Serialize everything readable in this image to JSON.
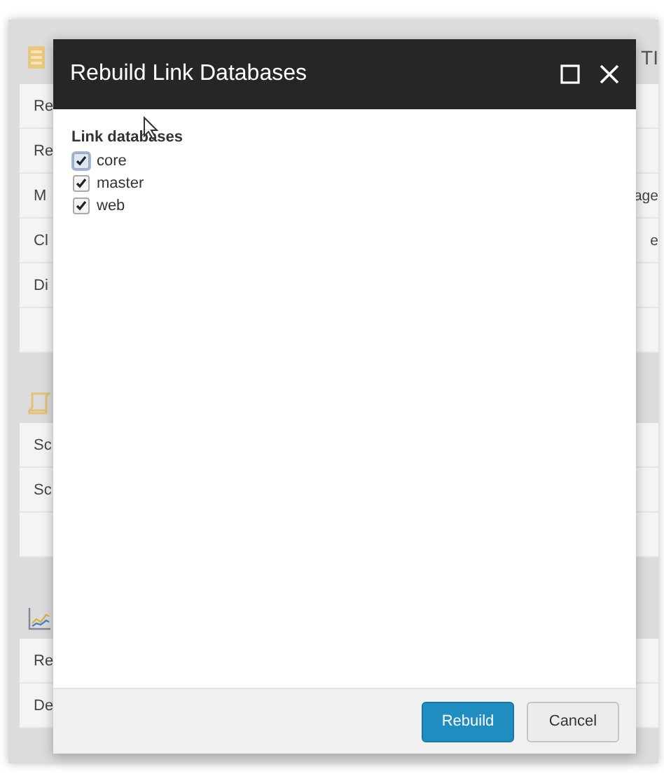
{
  "background": {
    "sections": [
      {
        "kind": "list",
        "heading_right": "TI",
        "rows": [
          {
            "left": "Re"
          },
          {
            "left": "Re"
          },
          {
            "left": "M",
            "right": "age"
          },
          {
            "left": "Cl",
            "right": "e"
          },
          {
            "left": "Di"
          },
          {}
        ]
      },
      {
        "kind": "scroll",
        "rows": [
          {
            "left": "Sc"
          },
          {
            "left": "Sc"
          },
          {}
        ]
      },
      {
        "kind": "chart",
        "rows": [
          {
            "left": "Re"
          },
          {
            "left": "De"
          }
        ]
      }
    ]
  },
  "dialog": {
    "title": "Rebuild Link Databases",
    "group_label": "Link databases",
    "options": [
      {
        "label": "core",
        "checked": true,
        "focused": true
      },
      {
        "label": "master",
        "checked": true,
        "focused": false
      },
      {
        "label": "web",
        "checked": true,
        "focused": false
      }
    ],
    "buttons": [
      {
        "label": "Rebuild",
        "kind": "primary"
      },
      {
        "label": "Cancel",
        "kind": "secondary"
      }
    ]
  }
}
